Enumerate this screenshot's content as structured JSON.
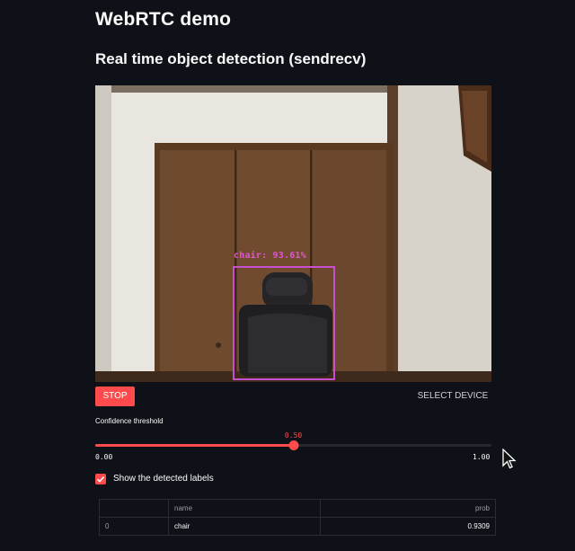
{
  "page_title": "WebRTC demo",
  "section_title": "Real time object detection (sendrecv)",
  "video": {
    "detection_label": "chair: 93.61%"
  },
  "buttons": {
    "stop_label": "STOP",
    "select_device_label": "SELECT DEVICE"
  },
  "slider": {
    "label": "Confidence threshold",
    "value": 0.5,
    "value_text": "0.50",
    "min_text": "0.00",
    "max_text": "1.00",
    "fill_color": "#ff4b4b"
  },
  "checkbox": {
    "label": "Show the detected labels",
    "checked": true
  },
  "table": {
    "columns": [
      "",
      "name",
      "prob"
    ],
    "rows": [
      {
        "index": "0",
        "name": "chair",
        "prob": "0.9309"
      }
    ]
  },
  "colors": {
    "background": "#0e1117",
    "accent": "#ff4b4b",
    "detection_box": "#c84fcf"
  }
}
